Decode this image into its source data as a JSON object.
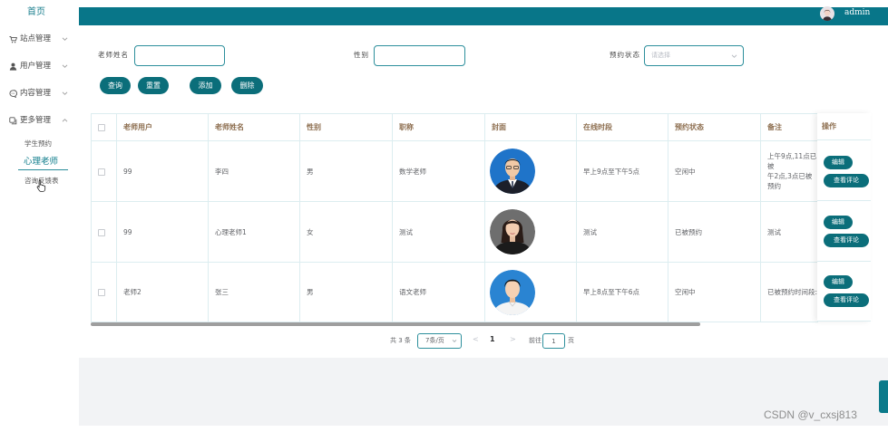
{
  "sidebar": {
    "home": "首页",
    "menus": [
      {
        "label": "站点管理",
        "icon": "cart-icon",
        "expanded": false
      },
      {
        "label": "用户管理",
        "icon": "user-icon",
        "expanded": false
      },
      {
        "label": "内容管理",
        "icon": "chat-icon",
        "expanded": false
      },
      {
        "label": "更多管理",
        "icon": "copy-icon",
        "expanded": true
      }
    ],
    "submenu": [
      {
        "label": "学生预约",
        "active": false
      },
      {
        "label": "心理老师",
        "active": true
      },
      {
        "label": "咨询反馈表",
        "active": false
      }
    ]
  },
  "header": {
    "username": "admin"
  },
  "search": {
    "name_label": "老师姓名",
    "name_value": "",
    "gender_label": "性别",
    "gender_value": "",
    "status_label": "预约状态",
    "status_placeholder": "请选择"
  },
  "actions": {
    "query": "查询",
    "reset": "重置",
    "add": "添加",
    "delete": "删除"
  },
  "table": {
    "columns": [
      "老师用户",
      "老师姓名",
      "性别",
      "职称",
      "封面",
      "在线时段",
      "预约状态",
      "备注",
      "操作"
    ],
    "rows": [
      {
        "username": "99",
        "name": "李四",
        "gender": "男",
        "title": "数学老师",
        "online_time": "早上9点至下午5点",
        "status": "空闲中",
        "remark": "上午9点,11点已被\n午2点,3点已被预约"
      },
      {
        "username": "99",
        "name": "心理老师1",
        "gender": "女",
        "title": "测试",
        "online_time": "测试",
        "status": "已被预约",
        "remark": "测试"
      },
      {
        "username": "老师2",
        "name": "张三",
        "gender": "男",
        "title": "语文老师",
        "online_time": "早上8点至下午6点",
        "status": "空闲中",
        "remark": "已被预约时间段:上"
      }
    ],
    "edit_label": "编辑",
    "review_label": "查看评论"
  },
  "pagination": {
    "total": "共 3 条",
    "page_size": "7条/页",
    "prev": "<",
    "current": "1",
    "next": ">",
    "goto_label": "前往",
    "goto_value": "1",
    "goto_suffix": "页"
  },
  "watermark": "CSDN @v_cxsj813",
  "colors": {
    "primary": "#087689",
    "button": "#0b6e7a",
    "table_header_text": "#8d6e4f",
    "table_border": "#dcedf0"
  }
}
